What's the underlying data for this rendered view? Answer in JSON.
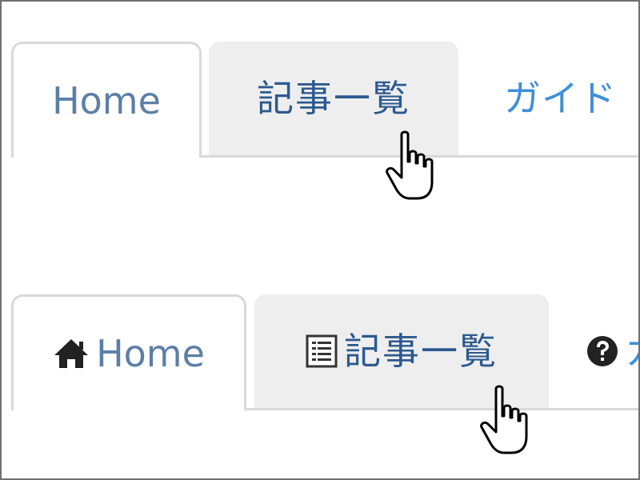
{
  "tabs_plain": [
    {
      "label": "Home",
      "state": "active"
    },
    {
      "label": "記事一覧",
      "state": "hovered"
    },
    {
      "label": "ガイド",
      "state": "normal"
    }
  ],
  "tabs_with_icons": [
    {
      "label": "Home",
      "icon": "home-icon",
      "state": "active"
    },
    {
      "label": "記事一覧",
      "icon": "list-icon",
      "state": "hovered"
    },
    {
      "label": "ガ",
      "icon": "question-circle-icon",
      "state": "normal"
    }
  ],
  "colors": {
    "tab_text": "#3b6fab",
    "hover_bg": "#eeeeee",
    "border": "#d9d9d9",
    "frame": "#6f6f6f"
  }
}
